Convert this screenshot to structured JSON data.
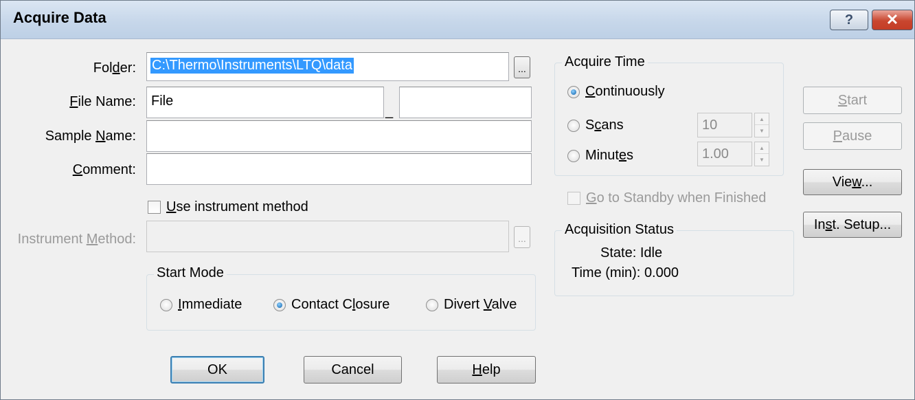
{
  "window": {
    "title": "Acquire Data",
    "help_glyph": "?",
    "close_glyph": "✕"
  },
  "form": {
    "folder": {
      "label": "Folder:",
      "mnemonic": "d",
      "value": "C:\\Thermo\\Instruments\\LTQ\\data",
      "browse_label": "..."
    },
    "file_name": {
      "label": "File Name:",
      "mnemonic": "F",
      "value": "File",
      "separator": "_",
      "suffix_value": ""
    },
    "sample_name": {
      "label": "Sample Name:",
      "mnemonic": "N",
      "value": ""
    },
    "comment": {
      "label": "Comment:",
      "mnemonic": "C",
      "value": ""
    },
    "use_instrument_method": {
      "label": "Use instrument method",
      "mnemonic": "U",
      "checked": false
    },
    "instrument_method": {
      "label": "Instrument Method:",
      "mnemonic": "M",
      "value": "",
      "browse_label": "..."
    }
  },
  "start_mode": {
    "title": "Start Mode",
    "options": [
      {
        "label": "Immediate",
        "mnemonic": "I",
        "selected": false
      },
      {
        "label": "Contact Closure",
        "mnemonic": "l",
        "selected": true
      },
      {
        "label": "Divert Valve",
        "mnemonic": "V",
        "selected": false
      }
    ]
  },
  "acquire_time": {
    "title": "Acquire Time",
    "options": [
      {
        "label": "Continuously",
        "mnemonic": "C",
        "selected": true
      },
      {
        "label": "Scans",
        "mnemonic": "c",
        "selected": false,
        "value": "10"
      },
      {
        "label": "Minutes",
        "mnemonic": "e",
        "selected": false,
        "value": "1.00"
      }
    ]
  },
  "standby": {
    "label": "Go to Standby when Finished",
    "mnemonic": "G",
    "checked": false
  },
  "acquisition_status": {
    "title": "Acquisition Status",
    "state_label": "State:",
    "state_value": "Idle",
    "time_label": "Time (min):",
    "time_value": "0.000"
  },
  "side_buttons": {
    "start": "Start",
    "pause": "Pause",
    "view": "View...",
    "inst_setup": "Inst. Setup..."
  },
  "bottom_buttons": {
    "ok": "OK",
    "cancel": "Cancel",
    "help": "Help"
  }
}
